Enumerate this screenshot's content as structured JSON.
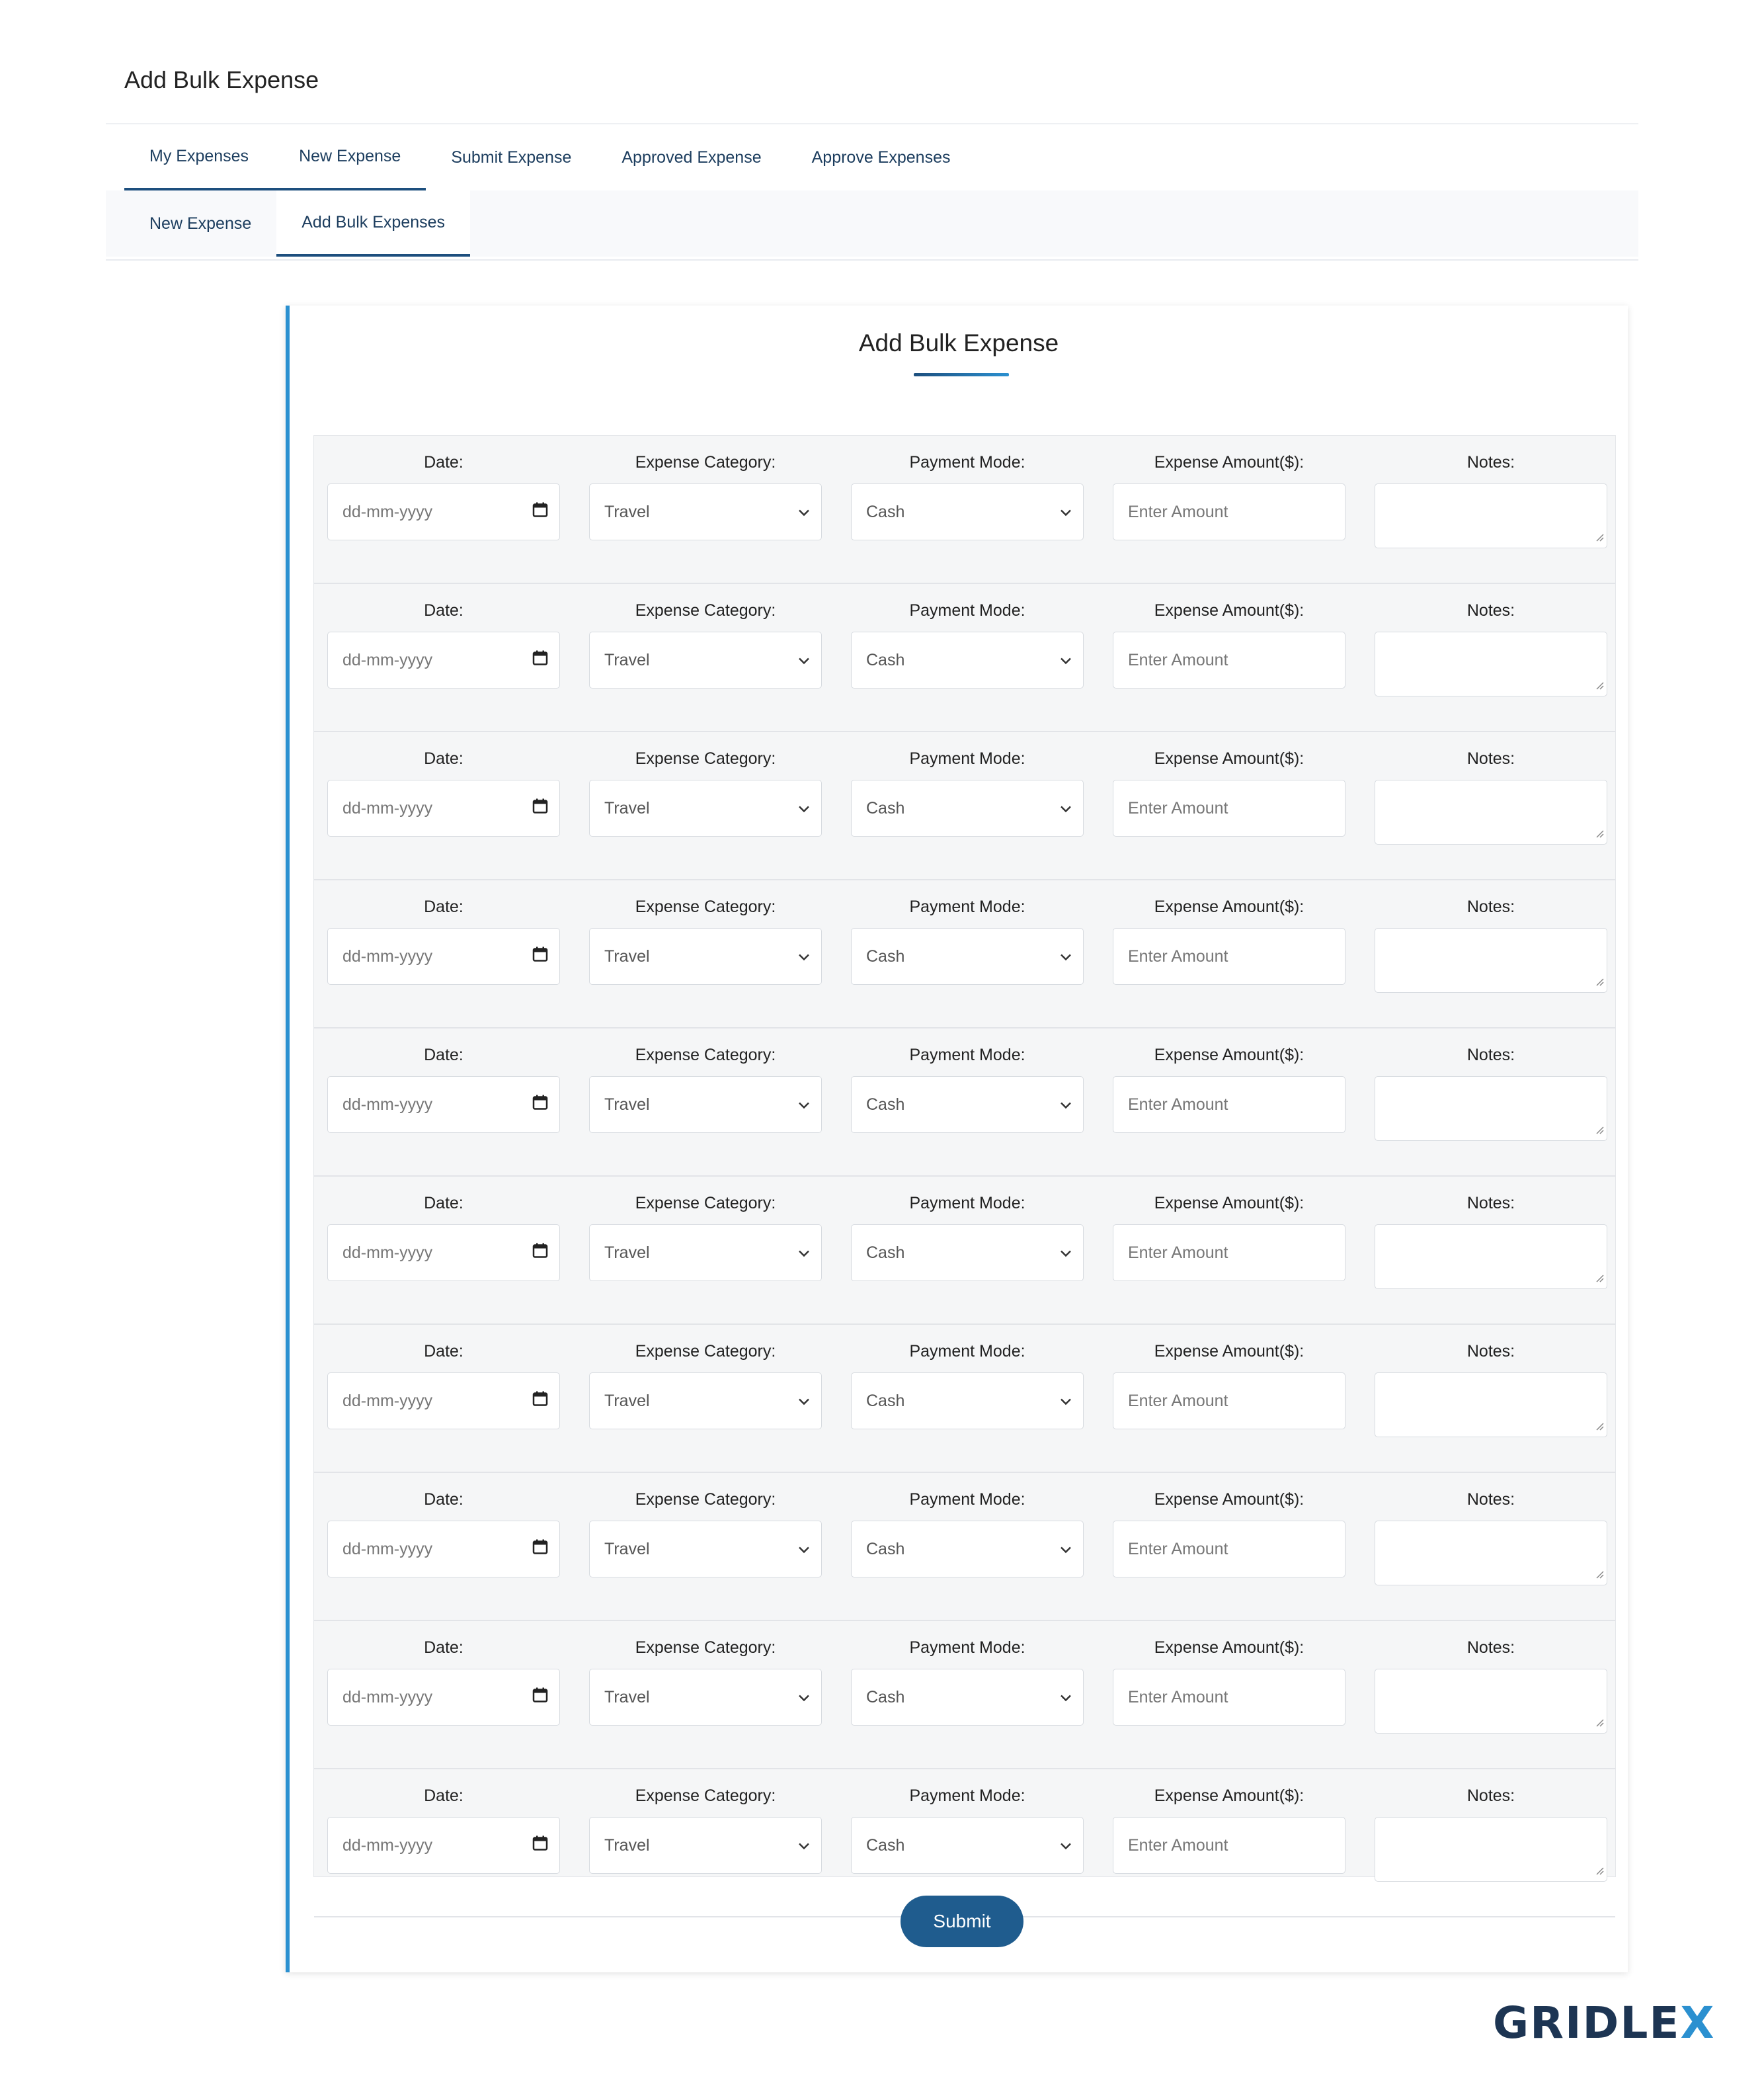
{
  "page_title": "Add Bulk Expense",
  "nav": {
    "primary_tabs": [
      {
        "label": "My Expenses",
        "active": true
      },
      {
        "label": "New Expense",
        "active": false
      },
      {
        "label": "Submit Expense",
        "active": false
      },
      {
        "label": "Approved Expense",
        "active": false
      },
      {
        "label": "Approve Expenses",
        "active": false
      }
    ],
    "secondary_tabs": [
      {
        "label": "New Expense",
        "active": false
      },
      {
        "label": "Add Bulk Expenses",
        "active": true
      }
    ]
  },
  "form": {
    "title": "Add Bulk Expense",
    "labels": {
      "date": "Date:",
      "category": "Expense Category:",
      "payment": "Payment Mode:",
      "amount": "Expense Amount($):",
      "notes": "Notes:"
    },
    "row_defaults": {
      "date_placeholder": "dd-mm-yyyy",
      "category_value": "Travel",
      "payment_value": "Cash",
      "amount_placeholder": "Enter Amount"
    },
    "row_count": 10,
    "submit_label": "Submit"
  },
  "logo": {
    "text_main": "GRIDLE",
    "text_accent": "X"
  },
  "colors": {
    "accent": "#2b90d0",
    "primary": "#1f5c8e",
    "nav_text": "#1c3d5e"
  },
  "icons": {
    "date_icon": "calendar-icon",
    "select_icon": "chevron-down-icon",
    "notes_icon": "resize-grip-icon"
  }
}
